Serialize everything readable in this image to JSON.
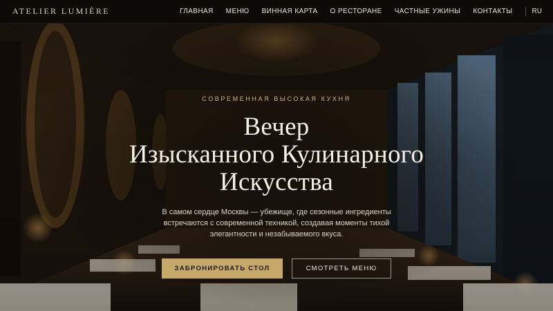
{
  "header": {
    "logo": "ATELIER LUMIÈRE",
    "nav": [
      "ГЛАВНАЯ",
      "МЕНЮ",
      "ВИННАЯ КАРТА",
      "О РЕСТОРАНЕ",
      "ЧАСТНЫЕ УЖИНЫ",
      "КОНТАКТЫ"
    ],
    "lang": "RU"
  },
  "hero": {
    "eyebrow": "СОВРЕМЕННАЯ ВЫСОКАЯ КУХНЯ",
    "headline": [
      "Вечер",
      "Изысканного Кулинарного",
      "Искусства"
    ],
    "description": "В самом сердце Москвы — убежище, где сезонные ингредиенты встречаются с современной техникой, создавая моменты тихой элегантности и незабываемого вкуса.",
    "primary_button": "ЗАБРОНИРОВАТЬ СТОЛ",
    "secondary_button": "СМОТРЕТЬ МЕНЮ"
  },
  "colors": {
    "accent_gold": "#c7a86b",
    "header_bg": "#0c0a08",
    "eyebrow": "#cdb58a"
  }
}
